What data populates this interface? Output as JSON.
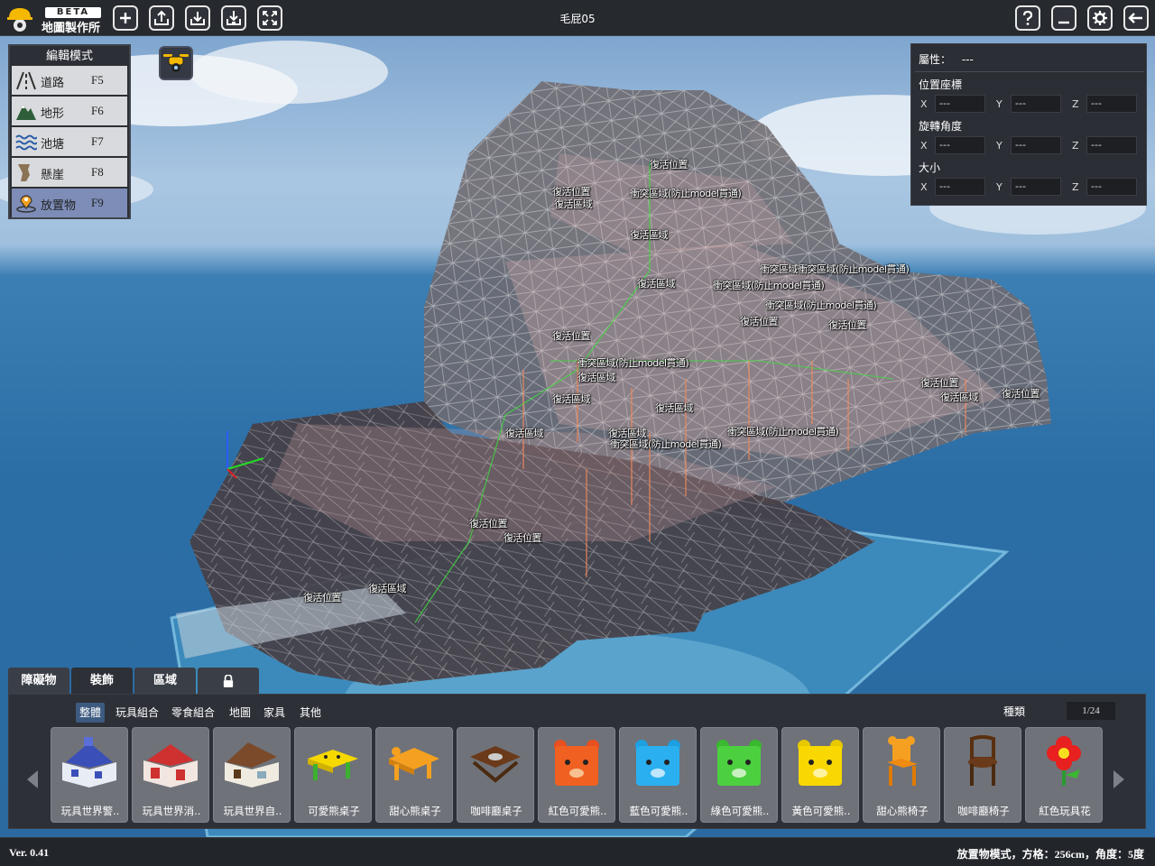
{
  "app": {
    "badge": "BETA",
    "title": "地圖製作所",
    "document_title": "毛屁05"
  },
  "toolbar": {
    "left_buttons": [
      {
        "icon": "plus-icon"
      },
      {
        "icon": "upload-icon"
      },
      {
        "icon": "download-icon"
      },
      {
        "icon": "import-icon"
      },
      {
        "icon": "fullscreen-icon"
      }
    ],
    "right_buttons": [
      {
        "icon": "help-icon"
      },
      {
        "icon": "minimize-icon"
      },
      {
        "icon": "settings-icon"
      },
      {
        "icon": "exit-icon"
      }
    ]
  },
  "edit_mode": {
    "title": "編輯模式",
    "items": [
      {
        "label": "道路",
        "key": "F5",
        "icon": "road-icon",
        "active": false
      },
      {
        "label": "地形",
        "key": "F6",
        "icon": "mountain-icon",
        "active": false
      },
      {
        "label": "池塘",
        "key": "F7",
        "icon": "water-icon",
        "active": false
      },
      {
        "label": "懸崖",
        "key": "F8",
        "icon": "cliff-icon",
        "active": false
      },
      {
        "label": "放置物",
        "key": "F9",
        "icon": "place-object-icon",
        "active": true
      }
    ]
  },
  "properties": {
    "attribute_label": "屬性：",
    "attribute_value": "---",
    "position_label": "位置座標",
    "rotation_label": "旋轉角度",
    "size_label": "大小",
    "position": {
      "x": "---",
      "y": "---",
      "z": "---"
    },
    "rotation": {
      "x": "---",
      "y": "---",
      "z": "---"
    },
    "size": {
      "x": "---",
      "y": "---",
      "z": "---"
    },
    "axis_x": "X",
    "axis_y": "Y",
    "axis_z": "Z"
  },
  "viewport_labels": [
    "復活位置",
    "衝突區域(防止model貫通)",
    "復活位置",
    "復活區域",
    "復活區域",
    "衝突區域衝突區域(防止model貫通)",
    "復活區域",
    "衝突區域(防止model貫通)",
    "衝突區域(防止model貫通)",
    "復活位置",
    "復活位置",
    "復活位置",
    "衝突區域(防止model貫通)",
    "復活區域",
    "復活區域",
    "衝突區域(防止model貫通)",
    "復活區域",
    "復活區域",
    "復活位置",
    "復活區域",
    "復活位置",
    "復活區域",
    "衝突區域(防止model貫通)",
    "復活位置",
    "復活位置",
    "復活區域",
    "復活位置"
  ],
  "asset_tabs": [
    {
      "label": "障礙物",
      "active": false
    },
    {
      "label": "裝飾",
      "active": true
    },
    {
      "label": "區域",
      "active": false
    },
    {
      "label": "",
      "icon": "lock-icon",
      "active": false
    }
  ],
  "asset_subtabs": [
    {
      "label": "整體",
      "active": true
    },
    {
      "label": "玩具組合",
      "active": false
    },
    {
      "label": "零食組合",
      "active": false
    },
    {
      "label": "地圖",
      "active": false
    },
    {
      "label": "家具",
      "active": false
    },
    {
      "label": "其他",
      "active": false
    }
  ],
  "sort_label": "種類",
  "page_indicator": "1/24",
  "assets": [
    {
      "name": "玩具世界警..",
      "icon": "police-station-icon"
    },
    {
      "name": "玩具世界消..",
      "icon": "fire-station-icon"
    },
    {
      "name": "玩具世界自..",
      "icon": "house-icon"
    },
    {
      "name": "可愛熊桌子",
      "icon": "bear-table-yellow-icon"
    },
    {
      "name": "甜心熊桌子",
      "icon": "bear-table-orange-icon"
    },
    {
      "name": "咖啡廳桌子",
      "icon": "cafe-table-icon"
    },
    {
      "name": "紅色可愛熊..",
      "icon": "red-bear-box-icon"
    },
    {
      "name": "藍色可愛熊..",
      "icon": "blue-bear-box-icon"
    },
    {
      "name": "綠色可愛熊..",
      "icon": "green-bear-box-icon"
    },
    {
      "name": "黃色可愛熊..",
      "icon": "yellow-bear-box-icon"
    },
    {
      "name": "甜心熊椅子",
      "icon": "bear-chair-icon"
    },
    {
      "name": "咖啡廳椅子",
      "icon": "cafe-chair-icon"
    },
    {
      "name": "紅色玩具花",
      "icon": "toy-flower-icon"
    }
  ],
  "status": {
    "version": "Ver. 0.41",
    "mode_text": "放置物模式，方格：256cm，角度：5度"
  },
  "colors": {
    "active_mode": "#7d8db8",
    "active_subtab": "#3d5a80",
    "panel_bg": "#2d3037",
    "ocean": "#2b6ea6"
  }
}
